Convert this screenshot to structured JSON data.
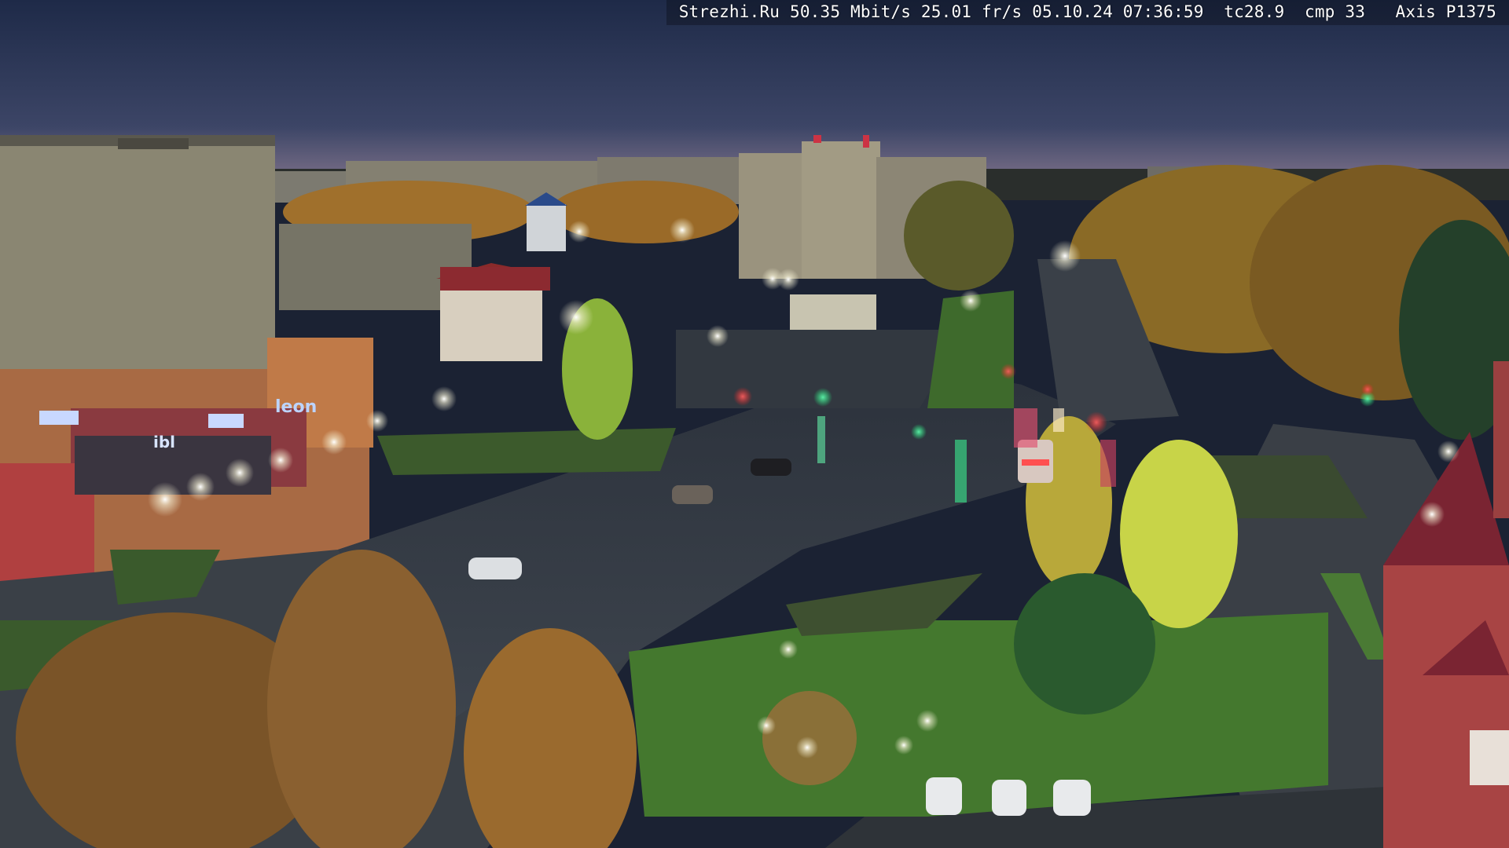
{
  "osd": {
    "text": "Strezhi.Ru 50.35 Mbit/s 25.01 fr/s 05.10.24 07:36:59  tc28.9  cmp 33   Axis P1375"
  },
  "storefront_signs": [
    "leon",
    "ibl"
  ],
  "colors": {
    "sky_top": "#1e2a48",
    "sky_horizon": "#6a6a8a",
    "road": "#3b4148",
    "grass": "#3f6a2a",
    "foliage_autumn": "#a8802e",
    "foliage_yellow": "#c8c84a",
    "building_panel": "#8a8672",
    "store_orange": "#c87840",
    "store_sign": "#8fb8ff",
    "street_light": "#f8f6e8",
    "traffic_red": "#ff3a3a",
    "traffic_green": "#3aff9a",
    "tower_roof": "#7a2432"
  }
}
